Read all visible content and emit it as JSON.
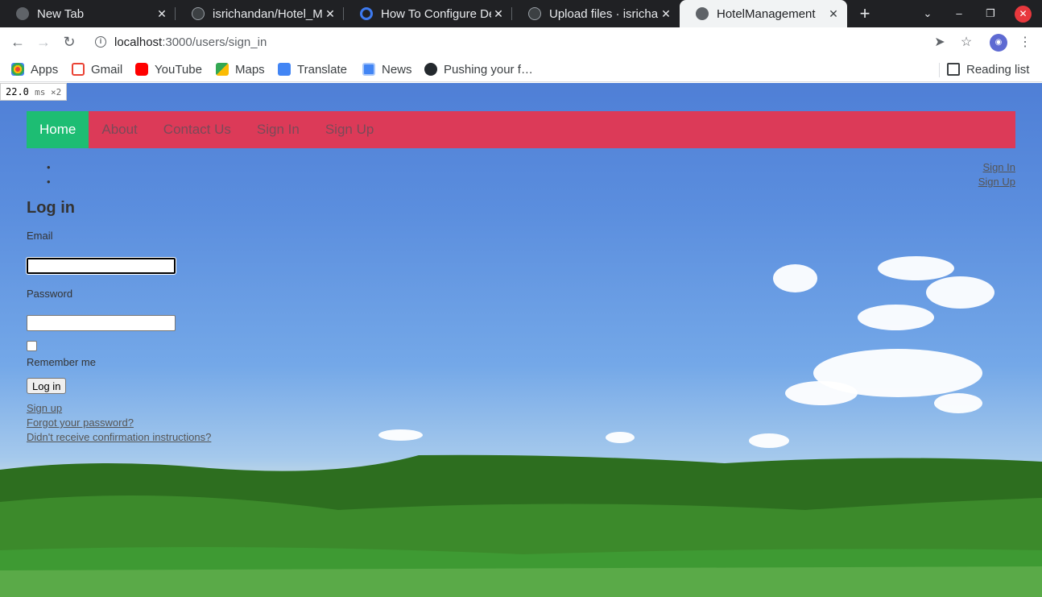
{
  "browser": {
    "tabs": [
      {
        "label": "New Tab",
        "icon": "chrome-icon"
      },
      {
        "label": "isrichandan/Hotel_M",
        "icon": "github-icon"
      },
      {
        "label": "How To Configure De",
        "icon": "digitalocean-icon"
      },
      {
        "label": "Upload files · isrichan",
        "icon": "github-icon"
      },
      {
        "label": "HotelManagement",
        "icon": "globe-icon"
      }
    ],
    "url_host": "localhost",
    "url_path": ":3000/users/sign_in",
    "bookmarks": [
      {
        "label": "Apps",
        "icon": "apps-grid-icon",
        "color": "#4285f4"
      },
      {
        "label": "Gmail",
        "icon": "gmail-icon",
        "color": "#ea4335"
      },
      {
        "label": "YouTube",
        "icon": "youtube-icon",
        "color": "#ff0000"
      },
      {
        "label": "Maps",
        "icon": "maps-icon",
        "color": "#34a853"
      },
      {
        "label": "Translate",
        "icon": "translate-icon",
        "color": "#4285f4"
      },
      {
        "label": "News",
        "icon": "news-icon",
        "color": "#4285f4"
      },
      {
        "label": "Pushing your f…",
        "icon": "github-icon",
        "color": "#24292e"
      }
    ],
    "reading_list": "Reading list"
  },
  "perf": {
    "value": "22.0",
    "unit": "ms ×2"
  },
  "nav": {
    "items": [
      "Home",
      "About",
      "Contact Us",
      "Sign In",
      "Sign Up"
    ],
    "active_color": "#1dbd73",
    "bar_color": "#dc3a58"
  },
  "account_links": [
    "Sign In",
    "Sign Up"
  ],
  "login": {
    "title": "Log in",
    "email_label": "Email",
    "password_label": "Password",
    "remember_label": "Remember me",
    "submit": "Log in"
  },
  "shared_links": [
    "Sign up",
    "Forgot your password?",
    "Didn't receive confirmation instructions?"
  ]
}
